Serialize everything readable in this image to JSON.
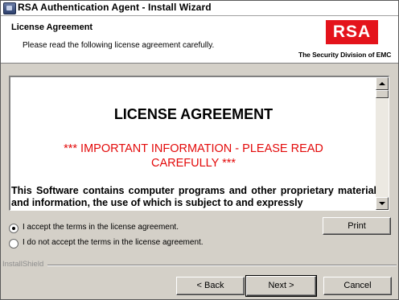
{
  "window": {
    "title": "RSA Authentication Agent - Install Wizard"
  },
  "header": {
    "title": "License Agreement",
    "subtitle": "Please read the following license agreement carefully.",
    "logo_text": "RSA",
    "tagline": "The Security Division of EMC",
    "logo_color": "#e4131b"
  },
  "license": {
    "heading": "LICENSE AGREEMENT",
    "important": "***  IMPORTANT INFORMATION - PLEASE READ CAREFULLY  ***",
    "body": "This Software contains computer programs and other proprietary material and information, the use of which is subject to and expressly",
    "important_color": "#e30a0a"
  },
  "options": {
    "accept": {
      "label": "I accept the terms in the license agreement.",
      "selected": true
    },
    "decline": {
      "label": "I do not accept the terms in the license agreement.",
      "selected": false
    }
  },
  "buttons": {
    "print": "Print",
    "back": "< Back",
    "next": "Next >",
    "cancel": "Cancel"
  },
  "footer": {
    "brand": "InstallShield"
  },
  "icons": {
    "app": "installer-app-icon",
    "scroll_up": "scroll-up-arrow-icon",
    "scroll_down": "scroll-down-arrow-icon"
  }
}
